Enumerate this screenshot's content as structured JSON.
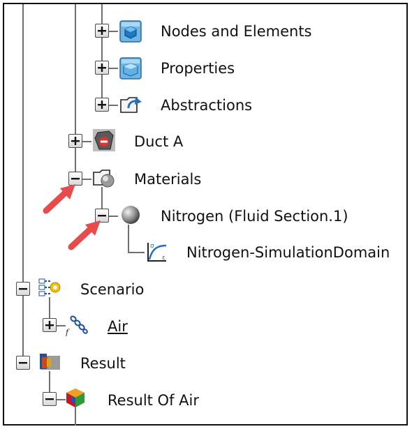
{
  "tree": {
    "nodes_and_elements": {
      "label": "Nodes and Elements",
      "expander": "plus",
      "icon": "cube-icon"
    },
    "properties": {
      "label": "Properties",
      "expander": "plus",
      "icon": "box-icon"
    },
    "abstractions": {
      "label": "Abstractions",
      "expander": "plus",
      "icon": "folder-arrow-icon"
    },
    "duct_a": {
      "label": "Duct A",
      "expander": "plus",
      "icon": "duct-icon"
    },
    "materials": {
      "label": "Materials",
      "expander": "minus",
      "icon": "folder-sphere-icon"
    },
    "nitrogen": {
      "label": "Nitrogen (Fluid Section.1)",
      "expander": "minus",
      "icon": "sphere-icon"
    },
    "nitrogen_domain": {
      "label": "Nitrogen-SimulationDomain",
      "icon": "curve-icon"
    },
    "scenario": {
      "label": "Scenario",
      "expander": "minus",
      "icon": "scenario-gear-icon"
    },
    "air": {
      "label": "Air",
      "expander": "plus",
      "icon": "chain-link-icon"
    },
    "result": {
      "label": "Result",
      "expander": "minus",
      "icon": "result-icon"
    },
    "result_of_air": {
      "label": "Result Of Air",
      "expander": "minus",
      "icon": "result-cube-icon"
    }
  },
  "annotations": {
    "arrow_color": "#e84b4b"
  },
  "colors": {
    "tree_line": "#6f6f6f",
    "frame": "#111111"
  }
}
